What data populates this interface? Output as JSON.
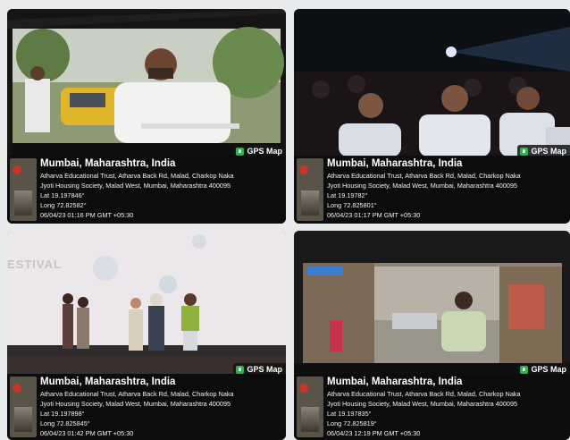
{
  "tiles": [
    {
      "gps_label": "GPS Map",
      "city": "Mumbai, Maharashtra, India",
      "address1": "Atharva Educational Trust, Atharva Back Rd, Malad, Charkop Naka",
      "address2": "Jyoti Housing Society, Malad West, Mumbai, Maharashtra 400095",
      "lat": "Lat 19.197846°",
      "long": "Long 72.82582°",
      "datetime": "06/04/23 01:16 PM GMT +05:30"
    },
    {
      "gps_label": "GPS Map",
      "city": "Mumbai, Maharashtra, India",
      "address1": "Atharva Educational Trust, Atharva Back Rd, Malad, Charkop Naka",
      "address2": "Jyoti Housing Society, Malad West, Mumbai, Maharashtra 400095",
      "lat": "Lat 19.19782°",
      "long": "Long 72.825801°",
      "datetime": "06/04/23 01:17 PM GMT +05:30"
    },
    {
      "gps_label": "GPS Map",
      "city": "Mumbai, Maharashtra, India",
      "address1": "Atharva Educational Trust, Atharva Back Rd, Malad, Charkop Naka",
      "address2": "Jyoti Housing Society, Malad West, Mumbai, Maharashtra 400095",
      "lat": "Lat 19.197898°",
      "long": "Long 72.825845°",
      "datetime": "06/04/23 01:42 PM GMT +05:30",
      "backdrop_text": "ESTIVAL"
    },
    {
      "gps_label": "GPS Map",
      "city": "Mumbai, Maharashtra, India",
      "address1": "Atharva Educational Trust, Atharva Back Rd, Malad, Charkop Naka",
      "address2": "Jyoti Housing Society, Malad West, Mumbai, Maharashtra 400095",
      "lat": "Lat 19.197835°",
      "long": "Long 72.825819°",
      "datetime": "06/04/23 12:19 PM GMT +05:30"
    }
  ]
}
